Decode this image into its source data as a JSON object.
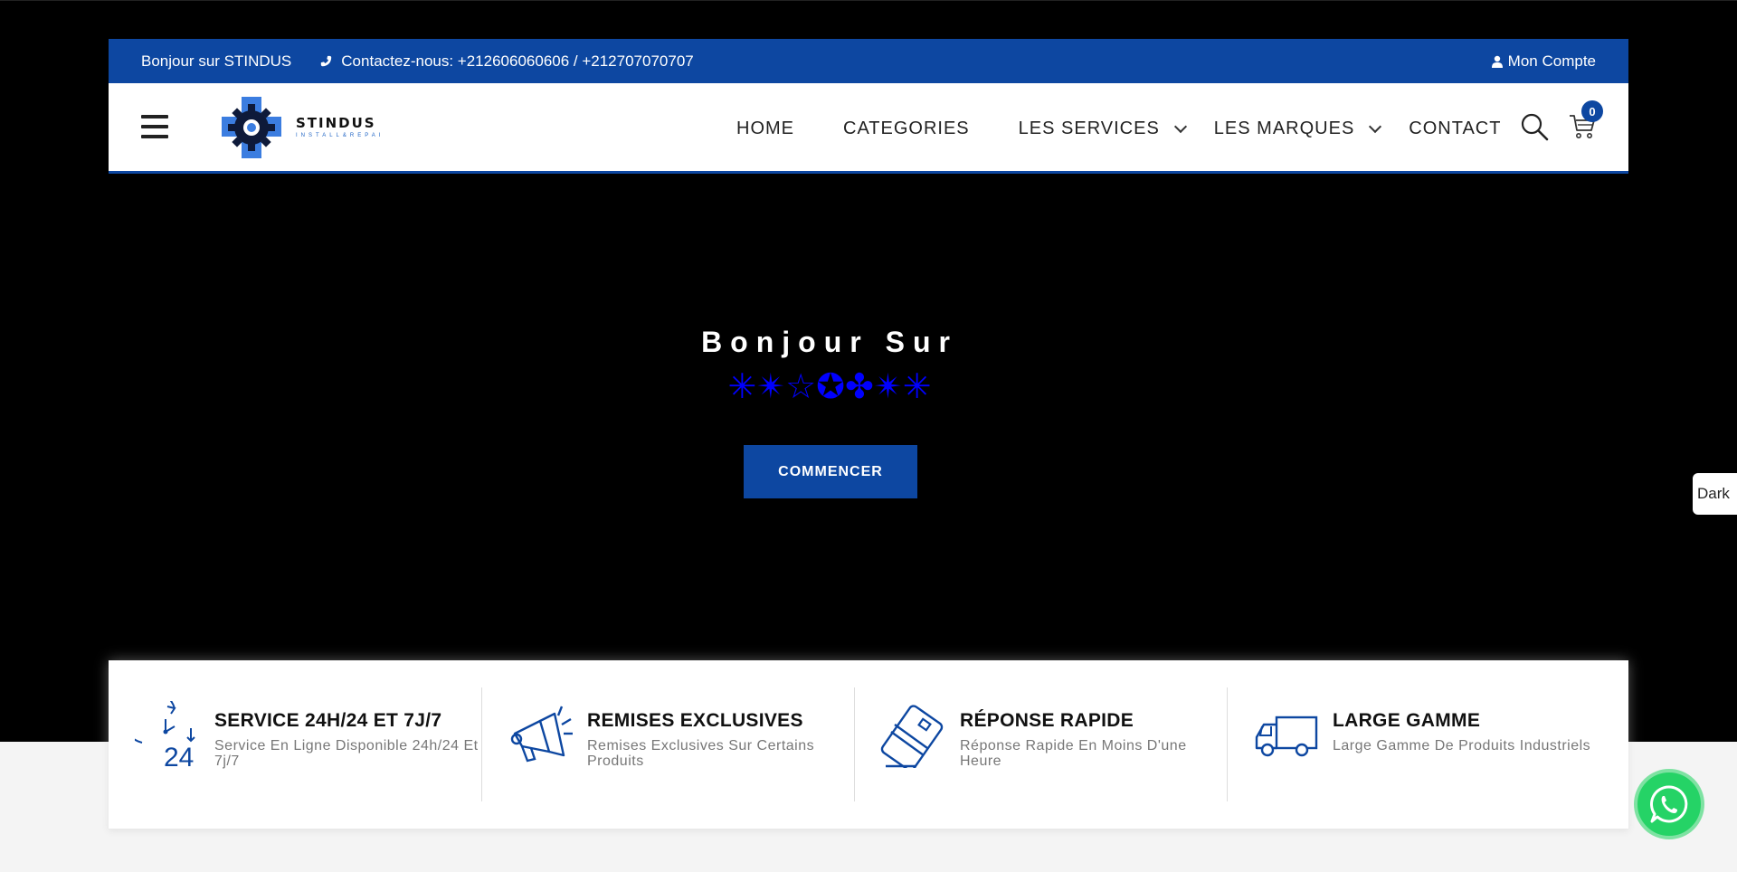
{
  "topbar": {
    "welcome": "Bonjour sur STINDUS",
    "contact": "Contactez-nous: +212606060606 / +212707070707",
    "account": "Mon Compte"
  },
  "logo": {
    "name": "STINDUS",
    "tagline": "INSTALL&REPAI"
  },
  "nav": {
    "items": [
      {
        "label": "HOME"
      },
      {
        "label": "CATEGORIES"
      },
      {
        "label": "LES SERVICES"
      },
      {
        "label": "LES MARQUES"
      },
      {
        "label": "CONTACT"
      }
    ],
    "cart_count": "0"
  },
  "hero": {
    "title": "Bonjour Sur",
    "stars": "✳✴☆✪✤✴✳",
    "button": "COMMENCER"
  },
  "dark_toggle": "Dark",
  "features": [
    {
      "icon": "clock-24-icon",
      "title": "SERVICE 24H/24 ET 7J/7",
      "desc": "Service En Ligne Disponible 24h/24 Et 7j/7"
    },
    {
      "icon": "megaphone-icon",
      "title": "REMISES EXCLUSIVES",
      "desc": "Remises Exclusives Sur Certains Produits"
    },
    {
      "icon": "credit-card-icon",
      "title": "RÉPONSE RAPIDE",
      "desc": "Réponse Rapide En Moins D'une Heure"
    },
    {
      "icon": "truck-icon",
      "title": "LARGE GAMME",
      "desc": "Large Gamme De Produits Industriels"
    }
  ],
  "colors": {
    "brand": "#0d47a1",
    "stars": "#0000ff",
    "whatsapp": "#25d366"
  }
}
